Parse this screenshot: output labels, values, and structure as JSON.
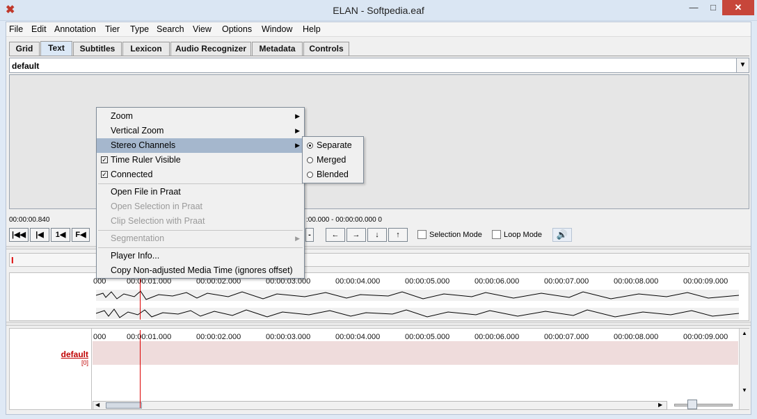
{
  "window": {
    "title": "ELAN - Softpedia.eaf",
    "min_glyph": "—",
    "max_glyph": "□",
    "close_glyph": "✕"
  },
  "menubar": [
    "File",
    "Edit",
    "Annotation",
    "Tier",
    "Type",
    "Search",
    "View",
    "Options",
    "Window",
    "Help"
  ],
  "tabs": [
    "Grid",
    "Text",
    "Subtitles",
    "Lexicon",
    "Audio Recognizer",
    "Metadata",
    "Controls"
  ],
  "active_tab": "Text",
  "text_viewer": {
    "tier_value": "default"
  },
  "media": {
    "current_time": "00:00:00.840",
    "selection_readout": ":00.000 - 00:00:00.000  0",
    "left_buttons": [
      "|◀◀",
      "|◀",
      "1◀",
      "F◀"
    ],
    "nav_buttons": [
      "←",
      "→",
      "↓",
      "↑"
    ],
    "selection_mode_label": "Selection Mode",
    "loop_mode_label": "Loop Mode"
  },
  "ruler_ticks": [
    "000",
    "00:00:01.000",
    "00:00:02.000",
    "00:00:03.000",
    "00:00:04.000",
    "00:00:05.000",
    "00:00:06.000",
    "00:00:07.000",
    "00:00:08.000",
    "00:00:09.000"
  ],
  "tier": {
    "name": "default",
    "count": "[0]"
  },
  "context_menu": {
    "items": [
      {
        "label": "Zoom",
        "submenu": true
      },
      {
        "label": "Vertical Zoom",
        "submenu": true
      },
      {
        "label": "Stereo Channels",
        "submenu": true,
        "highlighted": true
      },
      {
        "label": "Time Ruler Visible",
        "checked": true
      },
      {
        "label": "Connected",
        "checked": true
      },
      {
        "label": "Open File in Praat"
      },
      {
        "label": "Open Selection in Praat",
        "disabled": true
      },
      {
        "label": "Clip Selection with Praat",
        "disabled": true
      },
      {
        "label": "Segmentation",
        "submenu": true,
        "disabled": true
      },
      {
        "label": "Player Info..."
      },
      {
        "label": "Copy Non-adjusted Media Time (ignores offset)"
      }
    ],
    "stereo_submenu": [
      {
        "label": "Separate",
        "selected": true
      },
      {
        "label": "Merged",
        "selected": false
      },
      {
        "label": "Blended",
        "selected": false
      }
    ]
  }
}
